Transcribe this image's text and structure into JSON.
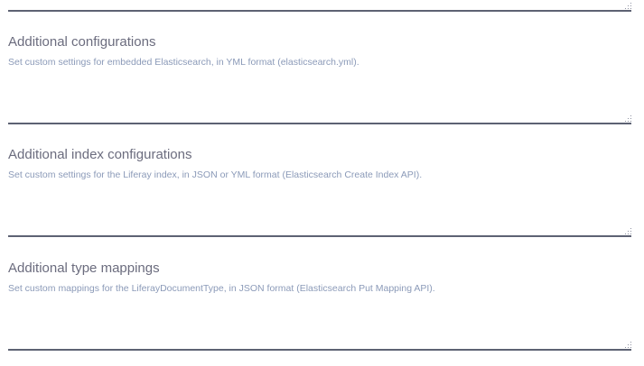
{
  "fields": [
    {
      "label": "",
      "help": ""
    },
    {
      "label": "Additional configurations",
      "help": "Set custom settings for embedded Elasticsearch, in YML format (elasticsearch.yml)."
    },
    {
      "label": "Additional index configurations",
      "help": "Set custom settings for the Liferay index, in JSON or YML format (Elasticsearch Create Index API)."
    },
    {
      "label": "Additional type mappings",
      "help": "Set custom mappings for the LiferayDocumentType, in JSON format (Elasticsearch Put Mapping API)."
    }
  ],
  "colors": {
    "label": "#6b6c7e",
    "help": "#8b9ab8",
    "border": "#5d6273"
  }
}
